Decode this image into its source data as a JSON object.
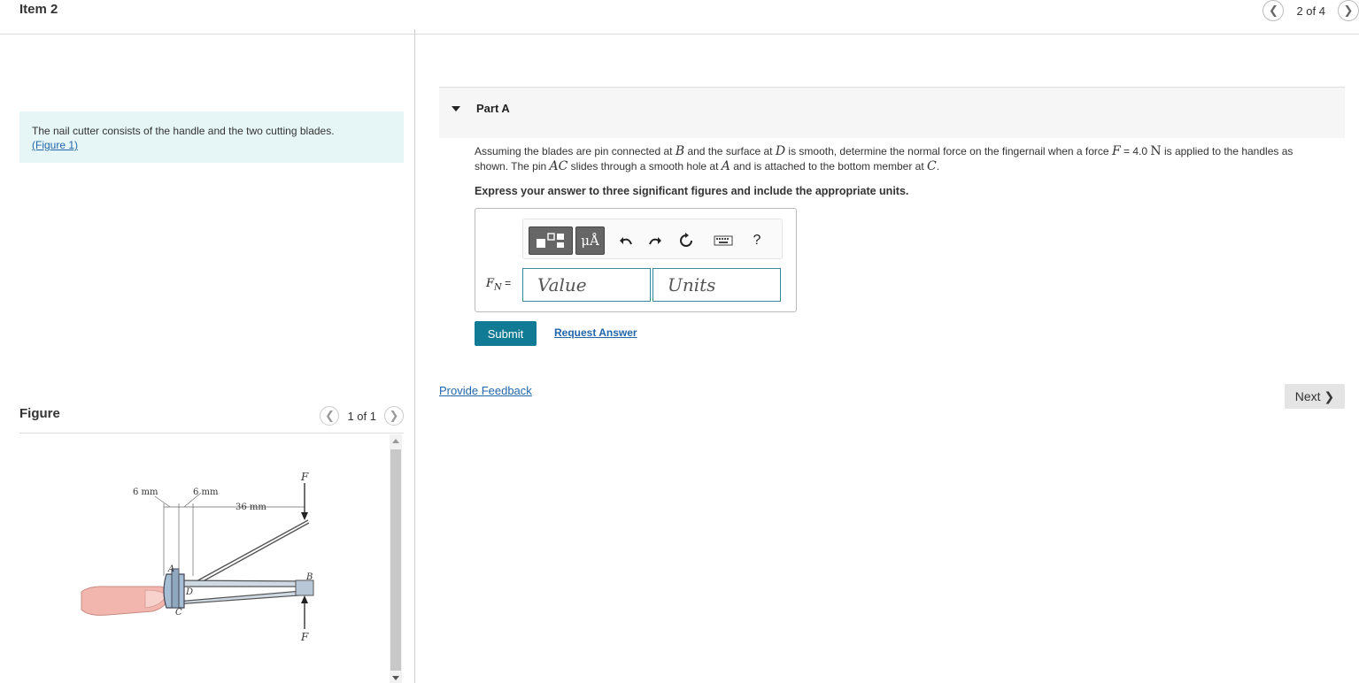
{
  "header": {
    "item_title": "Item 2",
    "pager_count": "2 of 4"
  },
  "intro": {
    "text": "The nail cutter consists of the handle and the two cutting blades.",
    "figure_link": "(Figure 1)"
  },
  "figure": {
    "label": "Figure",
    "pager_count": "1 of 1",
    "labels": {
      "dim_left": "6 mm",
      "dim_mid": "6 mm",
      "dim_long": "36 mm",
      "force_top": "F",
      "force_bottom": "F",
      "point_a": "A",
      "point_b": "B",
      "point_c": "C",
      "point_d": "D"
    }
  },
  "part": {
    "title": "Part A",
    "question_1": "Assuming the blades are pin connected at ",
    "var_b": "B",
    "question_2": " and the surface at ",
    "var_d": "D",
    "question_3": " is smooth, determine the normal force on the fingernail when a force ",
    "var_f": "F",
    "question_4": " = 4.0 ",
    "unit_n": "N",
    "question_5": " is applied to the handles as shown. The pin ",
    "var_ac": "AC",
    "question_6": " slides through a smooth hole at ",
    "var_a": "A",
    "question_7": " and is attached to the bottom member at ",
    "var_c": "C",
    "question_8": ".",
    "instruction": "Express your answer to three significant figures and include the appropriate units."
  },
  "answer": {
    "label_main": "F",
    "label_sub": "N",
    "label_eq": " =",
    "value_placeholder": "Value",
    "units_placeholder": "Units",
    "toolbar": {
      "mu_angstrom": "μÅ",
      "help": "?"
    }
  },
  "actions": {
    "submit": "Submit",
    "request_answer": "Request Answer",
    "provide_feedback": "Provide Feedback",
    "next": "Next"
  },
  "colors": {
    "accent": "#117a94",
    "link": "#2266aa",
    "intro_bg": "#e6f5f5"
  }
}
